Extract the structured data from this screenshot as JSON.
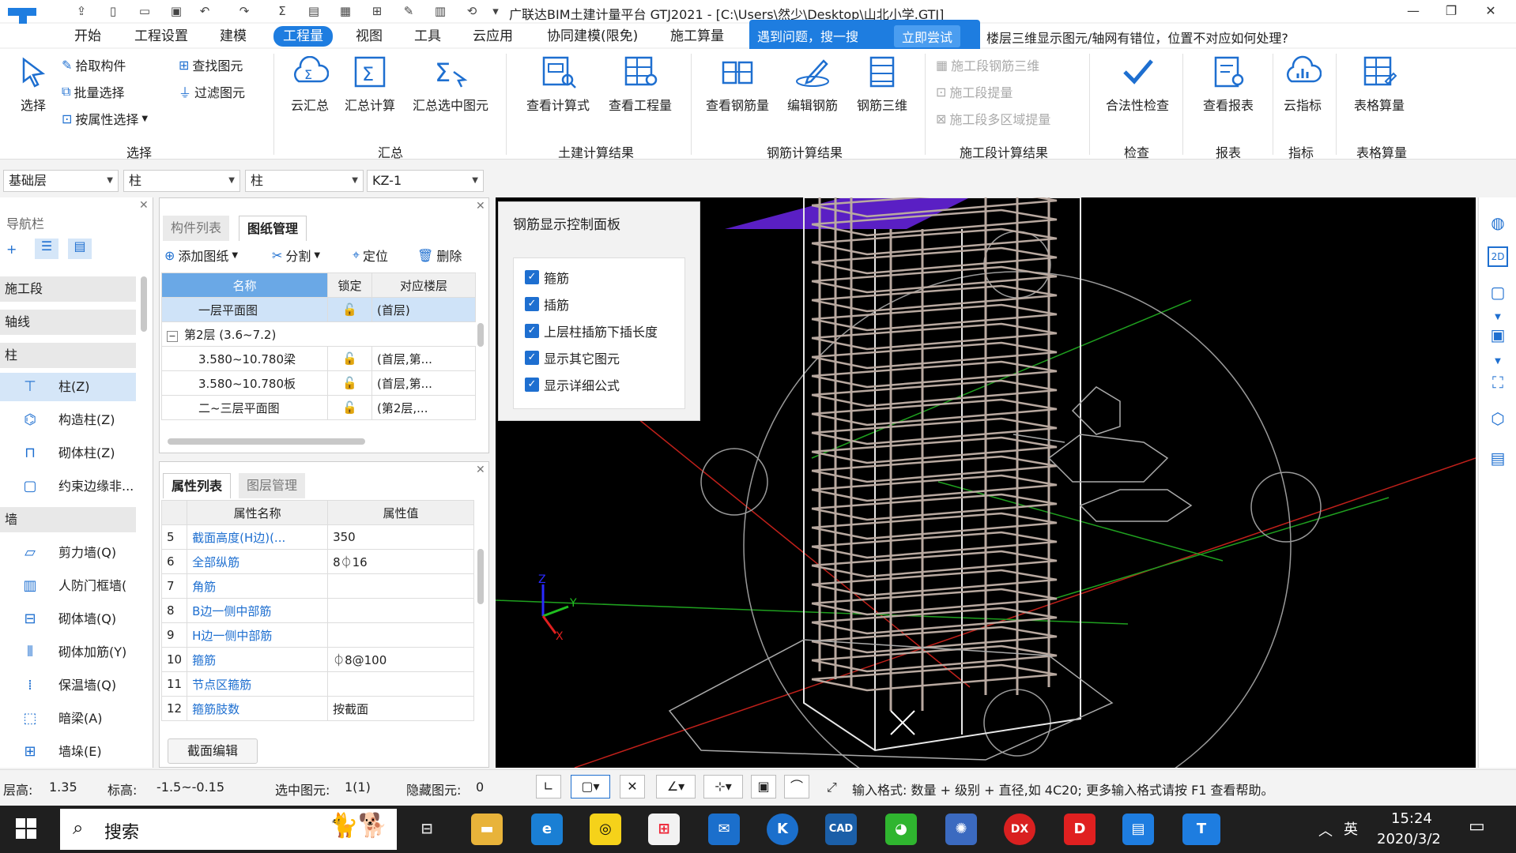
{
  "window": {
    "title": "广联达BIM土建计量平台 GTJ2021 - [C:\\Users\\然少\\Desktop\\山北小学.GTJ]",
    "controls": {
      "minimize": "—",
      "restore": "❐",
      "close": "✕"
    }
  },
  "menu": {
    "tabs": [
      "开始",
      "工程设置",
      "建模",
      "工程量",
      "视图",
      "工具",
      "云应用",
      "协同建模(限免)",
      "施工算量"
    ],
    "active": "工程量",
    "search_prompt": "遇到问题，搜一搜",
    "search_try": "立即尝试",
    "help_question": "楼层三维显示图元/轴网有错位，位置不对应如何处理?"
  },
  "ribbon": {
    "select": {
      "big": "选择",
      "pick": "拾取构件",
      "batch": "批量选择",
      "by_attr": "按属性选择",
      "find": "查找图元",
      "filter": "过滤图元",
      "group": "选择"
    },
    "summary": {
      "cloud": "云汇总",
      "calc": "汇总计算",
      "selected": "汇总选中图元",
      "group": "汇总"
    },
    "civil": {
      "formula": "查看计算式",
      "quantity": "查看工程量",
      "group": "土建计算结果"
    },
    "rebar": {
      "view": "查看钢筋量",
      "edit": "编辑钢筋",
      "three_d": "钢筋三维",
      "group": "钢筋计算结果"
    },
    "stage": {
      "rebar3d": "施工段钢筋三维",
      "extract": "施工段提量",
      "multi": "施工段多区域提量",
      "group": "施工段计算结果"
    },
    "check": {
      "label": "合法性检查",
      "group": "检查"
    },
    "report": {
      "label": "查看报表",
      "group": "报表"
    },
    "index": {
      "label": "云指标",
      "group": "指标"
    },
    "table": {
      "label": "表格算量",
      "group": "表格算量"
    }
  },
  "selectors": {
    "floor": "基础层",
    "category": "柱",
    "type": "柱",
    "component": "KZ-1"
  },
  "nav": {
    "title": "导航栏",
    "sections": [
      {
        "header": "施工段"
      },
      {
        "header": "轴线"
      },
      {
        "header": "柱"
      }
    ],
    "items": [
      "柱(Z)",
      "构造柱(Z)",
      "砌体柱(Z)",
      "约束边缘非..."
    ],
    "wall_header": "墙",
    "wall_items": [
      "剪力墙(Q)",
      "人防门框墙(",
      "砌体墙(Q)",
      "砌体加筋(Y)",
      "保温墙(Q)",
      "暗梁(A)",
      "墙垛(E)"
    ]
  },
  "drawings": {
    "tabs": [
      "构件列表",
      "图纸管理"
    ],
    "tools": {
      "add": "添加图纸",
      "split": "分割",
      "locate": "定位",
      "delete": "删除"
    },
    "columns": [
      "名称",
      "锁定",
      "对应楼层"
    ],
    "rows": [
      {
        "name": "一层平面图",
        "floor": "(首层)"
      },
      {
        "name": "第2层 (3.6~7.2)",
        "floor": ""
      },
      {
        "name": "3.580~10.780梁",
        "floor": "(首层,第..."
      },
      {
        "name": "3.580~10.780板",
        "floor": "(首层,第..."
      },
      {
        "name": "二~三层平面图",
        "floor": "(第2层,..."
      }
    ]
  },
  "properties": {
    "tabs": [
      "属性列表",
      "图层管理"
    ],
    "columns": [
      "属性名称",
      "属性值"
    ],
    "rows": [
      {
        "no": "5",
        "name": "截面高度(H边)(...",
        "value": "350"
      },
      {
        "no": "6",
        "name": "全部纵筋",
        "value": "8⏀16"
      },
      {
        "no": "7",
        "name": "角筋",
        "value": ""
      },
      {
        "no": "8",
        "name": "B边一侧中部筋",
        "value": ""
      },
      {
        "no": "9",
        "name": "H边一侧中部筋",
        "value": ""
      },
      {
        "no": "10",
        "name": "箍筋",
        "value": "⏀8@100"
      },
      {
        "no": "11",
        "name": "节点区箍筋",
        "value": ""
      },
      {
        "no": "12",
        "name": "箍筋肢数",
        "value": "按截面"
      }
    ],
    "edit_btn": "截面编辑"
  },
  "control_panel": {
    "title": "钢筋显示控制面板",
    "options": [
      "箍筋",
      "插筋",
      "上层柱插筋下插长度",
      "显示其它图元",
      "显示详细公式"
    ]
  },
  "status": {
    "floor_height_label": "层高:",
    "floor_height": "1.35",
    "elev_label": "标高:",
    "elev": "-1.5~-0.15",
    "selected_label": "选中图元:",
    "selected": "1(1)",
    "hidden_label": "隐藏图元:",
    "hidden": "0",
    "hint": "输入格式: 数量 + 级别 + 直径,如 4C20; 更多输入格式请按 F1 查看帮助。"
  },
  "taskbar": {
    "search": "搜索",
    "ime": "英",
    "time": "15:24",
    "date": "2020/3/2"
  },
  "colors": {
    "accent": "#1e7de0",
    "viewport": "#000000"
  }
}
